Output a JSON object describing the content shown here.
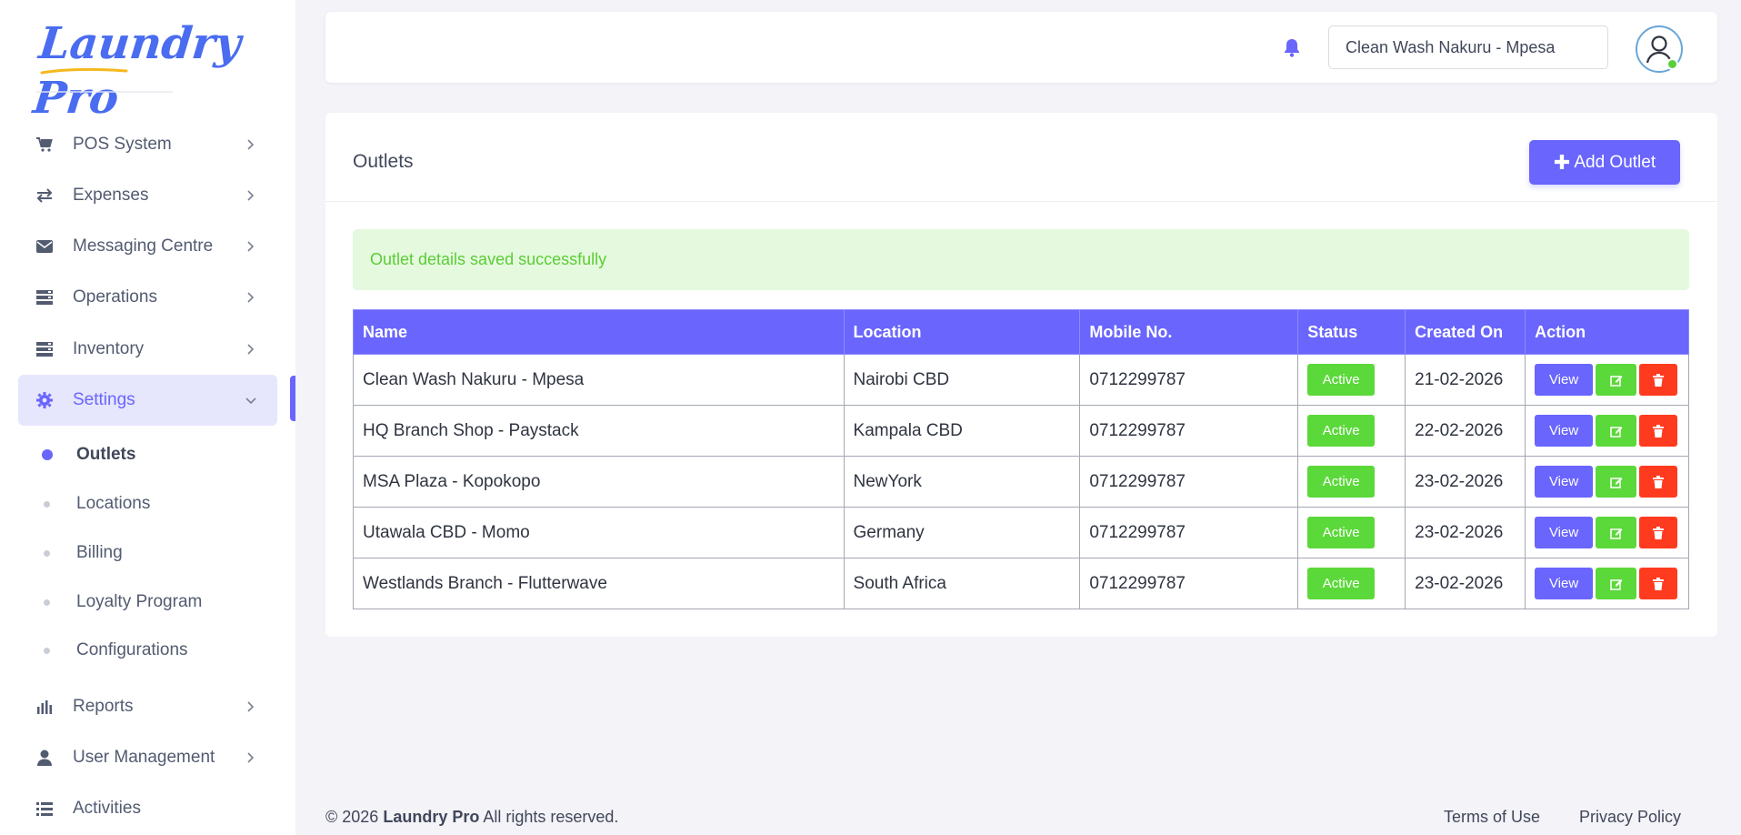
{
  "brand": {
    "logo_text": "Laundry Pro",
    "accent": "#6965fd"
  },
  "sidebar": {
    "items": [
      {
        "label": "POS System",
        "icon": "cart-icon"
      },
      {
        "label": "Expenses",
        "icon": "arrows-exchange-icon"
      },
      {
        "label": "Messaging Centre",
        "icon": "envelope-icon"
      },
      {
        "label": "Operations",
        "icon": "server-icon"
      },
      {
        "label": "Inventory",
        "icon": "server-icon"
      },
      {
        "label": "Settings",
        "icon": "gear-icon",
        "active": true
      },
      {
        "label": "Reports",
        "icon": "bar-chart-icon"
      },
      {
        "label": "User Management",
        "icon": "user-icon"
      },
      {
        "label": "Activities",
        "icon": "list-icon"
      }
    ],
    "settings_sub": [
      {
        "label": "Outlets",
        "active": true
      },
      {
        "label": "Locations"
      },
      {
        "label": "Billing"
      },
      {
        "label": "Loyalty Program"
      },
      {
        "label": "Configurations"
      }
    ]
  },
  "header": {
    "selected_outlet": "Clean Wash Nakuru - Mpesa",
    "status_color": "#58cf3a"
  },
  "main": {
    "title": "Outlets",
    "add_button": "Add Outlet",
    "alert": "Outlet details saved successfully",
    "columns": [
      "Name",
      "Location",
      "Mobile No.",
      "Status",
      "Created On",
      "Action"
    ],
    "rows": [
      {
        "name": "Clean Wash Nakuru - Mpesa",
        "location": "Nairobi CBD",
        "mobile": "0712299787",
        "status": "Active",
        "created": "21-02-2026"
      },
      {
        "name": "HQ Branch Shop -  Paystack",
        "location": "Kampala CBD",
        "mobile": "0712299787",
        "status": "Active",
        "created": "22-02-2026"
      },
      {
        "name": "MSA Plaza - Kopokopo",
        "location": "NewYork",
        "mobile": "0712299787",
        "status": "Active",
        "created": "23-02-2026"
      },
      {
        "name": "Utawala CBD - Momo",
        "location": "Germany",
        "mobile": "0712299787",
        "status": "Active",
        "created": "23-02-2026"
      },
      {
        "name": "Westlands Branch - Flutterwave",
        "location": "South Africa",
        "mobile": "0712299787",
        "status": "Active",
        "created": "23-02-2026"
      }
    ],
    "action_view": "View"
  },
  "footer": {
    "copy_prefix": "© 2026",
    "copy_brand": "Laundry Pro",
    "copy_suffix": "All rights reserved.",
    "terms": "Terms of Use",
    "privacy": "Privacy Policy"
  }
}
